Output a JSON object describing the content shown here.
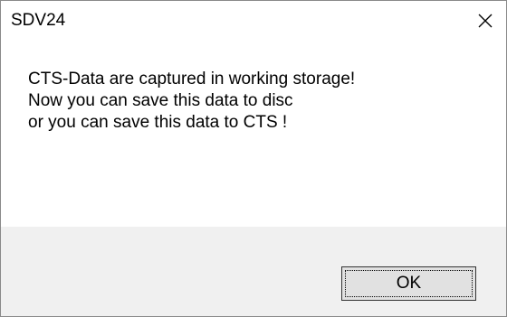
{
  "window": {
    "title": "SDV24",
    "close_icon": "close-icon"
  },
  "message": {
    "lines": [
      "CTS-Data are captured in working storage!",
      "Now you can save this data to disc",
      "or you can save this data to CTS !"
    ]
  },
  "buttons": {
    "ok_label": "OK"
  },
  "colors": {
    "footer_bg": "#f0f0f0",
    "button_bg": "#e1e1e1",
    "border": "#8a8a8a"
  }
}
